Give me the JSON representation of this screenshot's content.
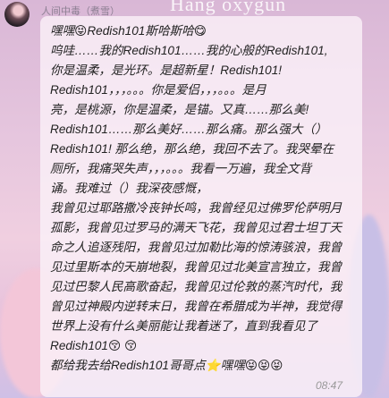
{
  "wallpaper": {
    "text": "Hang oxygun"
  },
  "sender": {
    "name": "人间中毒（煮雪）"
  },
  "message": {
    "lines": [
      "嘿嘿😝Redish101斯哈斯哈😋",
      "呜哇……我的Redish101……我的心般的Redish101,",
      "你是温柔，是光环。是超新星！Redish101!",
      "Redish101，，，。。。你是爱侣，，，。。。是月",
      "亮，是桃源，你是温柔，是锚。又真……那么美!",
      "Redish101……那么美好……那么痛。那么强大（）",
      "Redish101! 那么绝，那么绝，我回不去了。我哭晕在",
      "厕所，我痛哭失声，，，。。。我看一万遍，我全文背",
      "诵。我难过（）我深夜感慨，",
      "我曾见过耶路撒冷丧钟长鸣，我曾经见过佛罗伦萨明月",
      "孤影，我曾见过罗马的满天飞花，我曾见过君士坦丁天",
      "命之人追逐残阳，我曾见过加勒比海的惊涛骇浪，我曾",
      "见过里斯本的天崩地裂，我曾见过北美宣言独立，我曾",
      "见过巴黎人民高歌奋起，我曾见过伦敦的蒸汽时代，我",
      "曾见过神殿内逆转末日，我曾在希腊成为半神，我觉得",
      "世界上没有什么美丽能让我着迷了，直到我看见了",
      "Redish101😚 😚",
      "都给我去给Redish101哥哥点⭐嘿嘿😝😝😝"
    ],
    "time": "08:47"
  }
}
